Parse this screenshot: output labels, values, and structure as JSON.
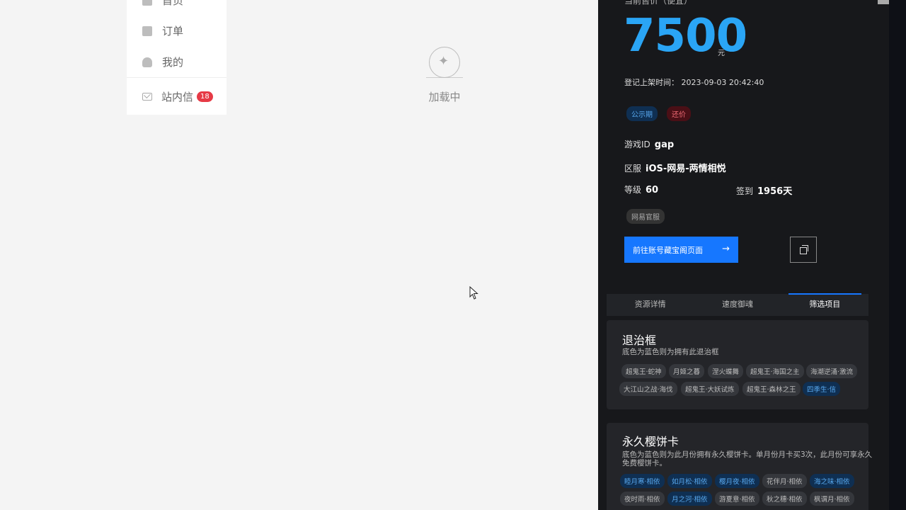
{
  "nav": {
    "items": [
      {
        "label": "首页"
      },
      {
        "label": "订单"
      },
      {
        "label": "我的"
      }
    ],
    "mail": {
      "label": "站内信",
      "badge": "18"
    }
  },
  "loading": {
    "text": "加载中"
  },
  "panel": {
    "price_label_cut": "当前售价（便宜）",
    "price": "7500",
    "price_unit": "元",
    "list_time": "登记上架时间：  2023-09-03 20:42:40",
    "tags": [
      "公示期",
      "还价"
    ],
    "game_id_label": "游戏ID",
    "game_id": "gap",
    "server_label": "区服",
    "server": "iOS-网易-两情相悦",
    "level_label": "等级",
    "level": "60",
    "signin_label": "签到",
    "signin": "1956天",
    "official_tag": "网易官服",
    "goto_button": "前往账号藏宝阁页面",
    "tabs": [
      "资源详情",
      "速度御魂",
      "筛选项目"
    ],
    "active_tab": "筛选项目",
    "card1": {
      "title": "退治框",
      "desc": "底色为蓝色则为拥有此退治框",
      "chips": [
        {
          "label": "超鬼王·蛇神",
          "on": false
        },
        {
          "label": "月姬之暮",
          "on": false
        },
        {
          "label": "涅火蝶舞",
          "on": false
        },
        {
          "label": "超鬼王·海国之主",
          "on": false
        },
        {
          "label": "海潮逆涌·激流",
          "on": false
        },
        {
          "label": "大江山之战·海伐",
          "on": false
        },
        {
          "label": "超鬼王·大妖试炼",
          "on": false
        },
        {
          "label": "超鬼王·森林之王",
          "on": false
        },
        {
          "label": "四季生·信",
          "on": true
        }
      ]
    },
    "card2": {
      "title": "永久樱饼卡",
      "desc": "底色为蓝色则为此月份拥有永久樱饼卡。单月份月卡买3次，此月份可享永久免费樱饼卡。",
      "chips": [
        {
          "label": "睦月寒·相依",
          "on": true
        },
        {
          "label": "如月松·相依",
          "on": true
        },
        {
          "label": "樱月夜·相依",
          "on": true
        },
        {
          "label": "花伴月·相依",
          "on": false
        },
        {
          "label": "海之味·相依",
          "on": true
        },
        {
          "label": "夜时雨·相依",
          "on": false
        },
        {
          "label": "月之河·相依",
          "on": true
        },
        {
          "label": "游夏意·相依",
          "on": false
        },
        {
          "label": "秋之穗·相依",
          "on": false
        },
        {
          "label": "枫谓月·相依",
          "on": false
        }
      ]
    }
  }
}
